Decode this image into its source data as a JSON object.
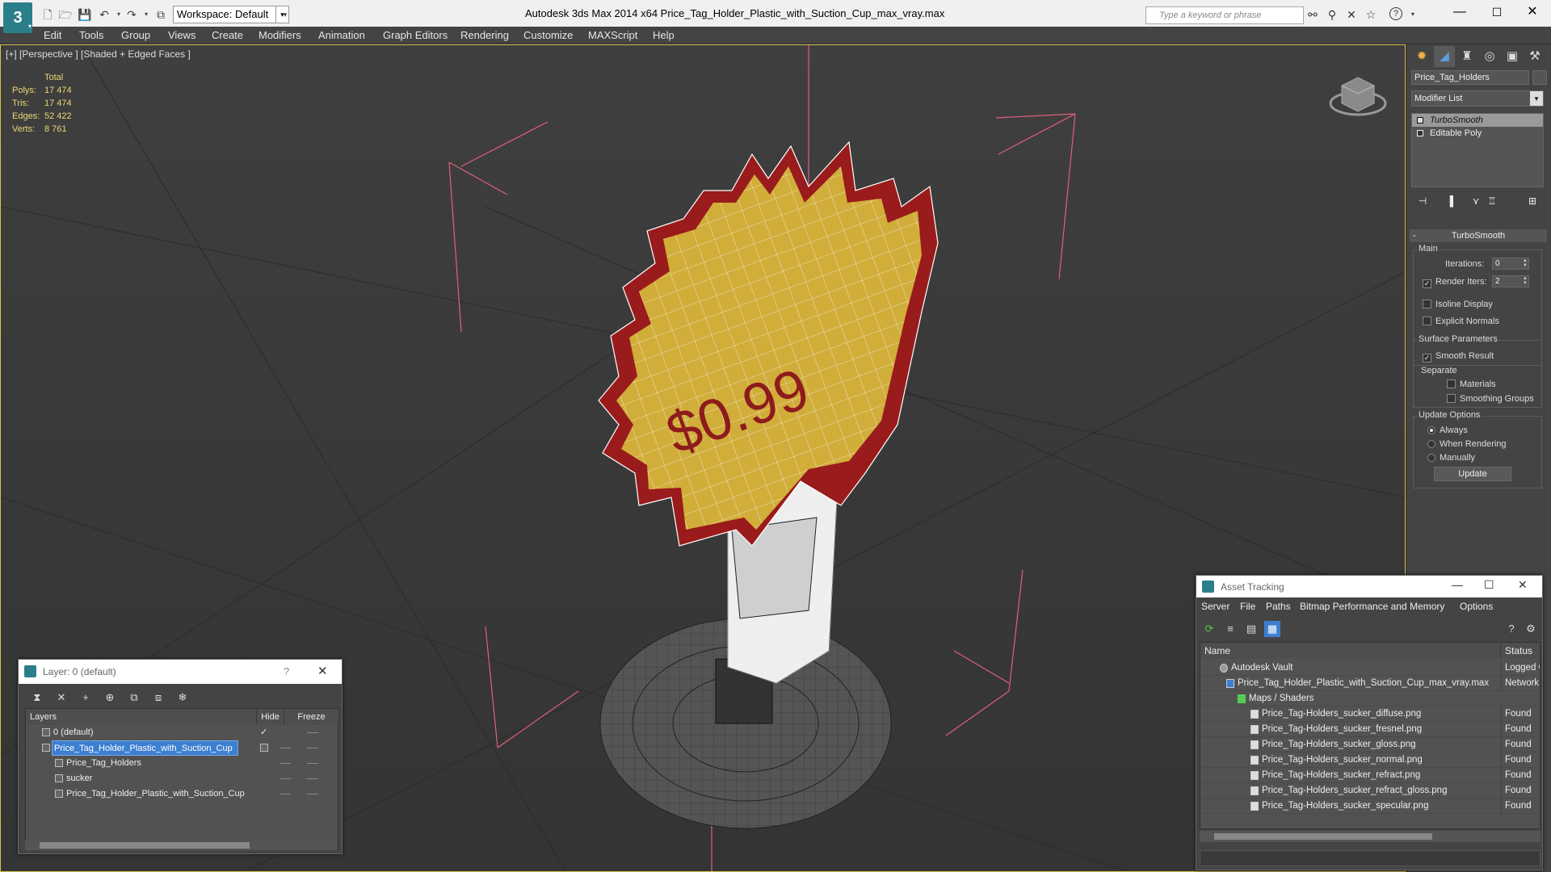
{
  "title_bar": {
    "logo": "3",
    "workspace": "Workspace: Default",
    "app_title": "Autodesk 3ds Max  2014 x64      Price_Tag_Holder_Plastic_with_Suction_Cup_max_vray.max",
    "search_placeholder": "Type a keyword or phrase"
  },
  "menu": [
    "Edit",
    "Tools",
    "Group",
    "Views",
    "Create",
    "Modifiers",
    "Animation",
    "Graph Editors",
    "Rendering",
    "Customize",
    "MAXScript",
    "Help"
  ],
  "viewport": {
    "label": "[+] [Perspective ] [Shaded + Edged Faces ]",
    "stats_header": "Total",
    "stats": [
      {
        "k": "Polys:",
        "v": "17 474"
      },
      {
        "k": "Tris:",
        "v": "17 474"
      },
      {
        "k": "Edges:",
        "v": "52 422"
      },
      {
        "k": "Verts:",
        "v": "8 761"
      }
    ],
    "price_text": "$0.99"
  },
  "command_panel": {
    "object_name": "Price_Tag_Holders",
    "modifier_list": "Modifier List",
    "stack": [
      {
        "label": "TurboSmooth",
        "selected": true
      },
      {
        "label": "Editable Poly",
        "selected": false
      }
    ],
    "rollout_title": "TurboSmooth",
    "main_group": "Main",
    "iterations_label": "Iterations:",
    "iterations_value": "0",
    "render_iters_label": "Render Iters:",
    "render_iters_value": "2",
    "isoline": "Isoline Display",
    "explicit_normals": "Explicit Normals",
    "surface_params": "Surface Parameters",
    "smooth_result": "Smooth Result",
    "separate": "Separate",
    "materials": "Materials",
    "smoothing_groups": "Smoothing Groups",
    "update_options": "Update Options",
    "always": "Always",
    "when_rendering": "When Rendering",
    "manually": "Manually",
    "update": "Update"
  },
  "layer_dialog": {
    "title": "Layer: 0 (default)",
    "help": "?",
    "col_layers": "Layers",
    "col_hide": "Hide",
    "col_freeze": "Freeze",
    "rows": [
      {
        "name": "0 (default)",
        "indent": 0,
        "selected": false
      },
      {
        "name": "Price_Tag_Holder_Plastic_with_Suction_Cup",
        "indent": 0,
        "selected": true
      },
      {
        "name": "Price_Tag_Holders",
        "indent": 1,
        "selected": false
      },
      {
        "name": "sucker",
        "indent": 1,
        "selected": false
      },
      {
        "name": "Price_Tag_Holder_Plastic_with_Suction_Cup",
        "indent": 1,
        "selected": false
      }
    ]
  },
  "asset_dialog": {
    "title": "Asset Tracking",
    "menu": [
      "Server",
      "File",
      "Paths",
      "Bitmap Performance and Memory",
      "Options"
    ],
    "col_name": "Name",
    "col_status": "Status",
    "rows": [
      {
        "name": "Autodesk Vault",
        "indent": 1,
        "status": "Logged O"
      },
      {
        "name": "Price_Tag_Holder_Plastic_with_Suction_Cup_max_vray.max",
        "indent": 2,
        "status": "Network I"
      },
      {
        "name": "Maps / Shaders",
        "indent": 3,
        "status": ""
      },
      {
        "name": "Price_Tag-Holders_sucker_diffuse.png",
        "indent": 4,
        "status": "Found"
      },
      {
        "name": "Price_Tag-Holders_sucker_fresnel.png",
        "indent": 4,
        "status": "Found"
      },
      {
        "name": "Price_Tag-Holders_sucker_gloss.png",
        "indent": 4,
        "status": "Found"
      },
      {
        "name": "Price_Tag-Holders_sucker_normal.png",
        "indent": 4,
        "status": "Found"
      },
      {
        "name": "Price_Tag-Holders_sucker_refract.png",
        "indent": 4,
        "status": "Found"
      },
      {
        "name": "Price_Tag-Holders_sucker_refract_gloss.png",
        "indent": 4,
        "status": "Found"
      },
      {
        "name": "Price_Tag-Holders_sucker_specular.png",
        "indent": 4,
        "status": "Found"
      }
    ]
  }
}
